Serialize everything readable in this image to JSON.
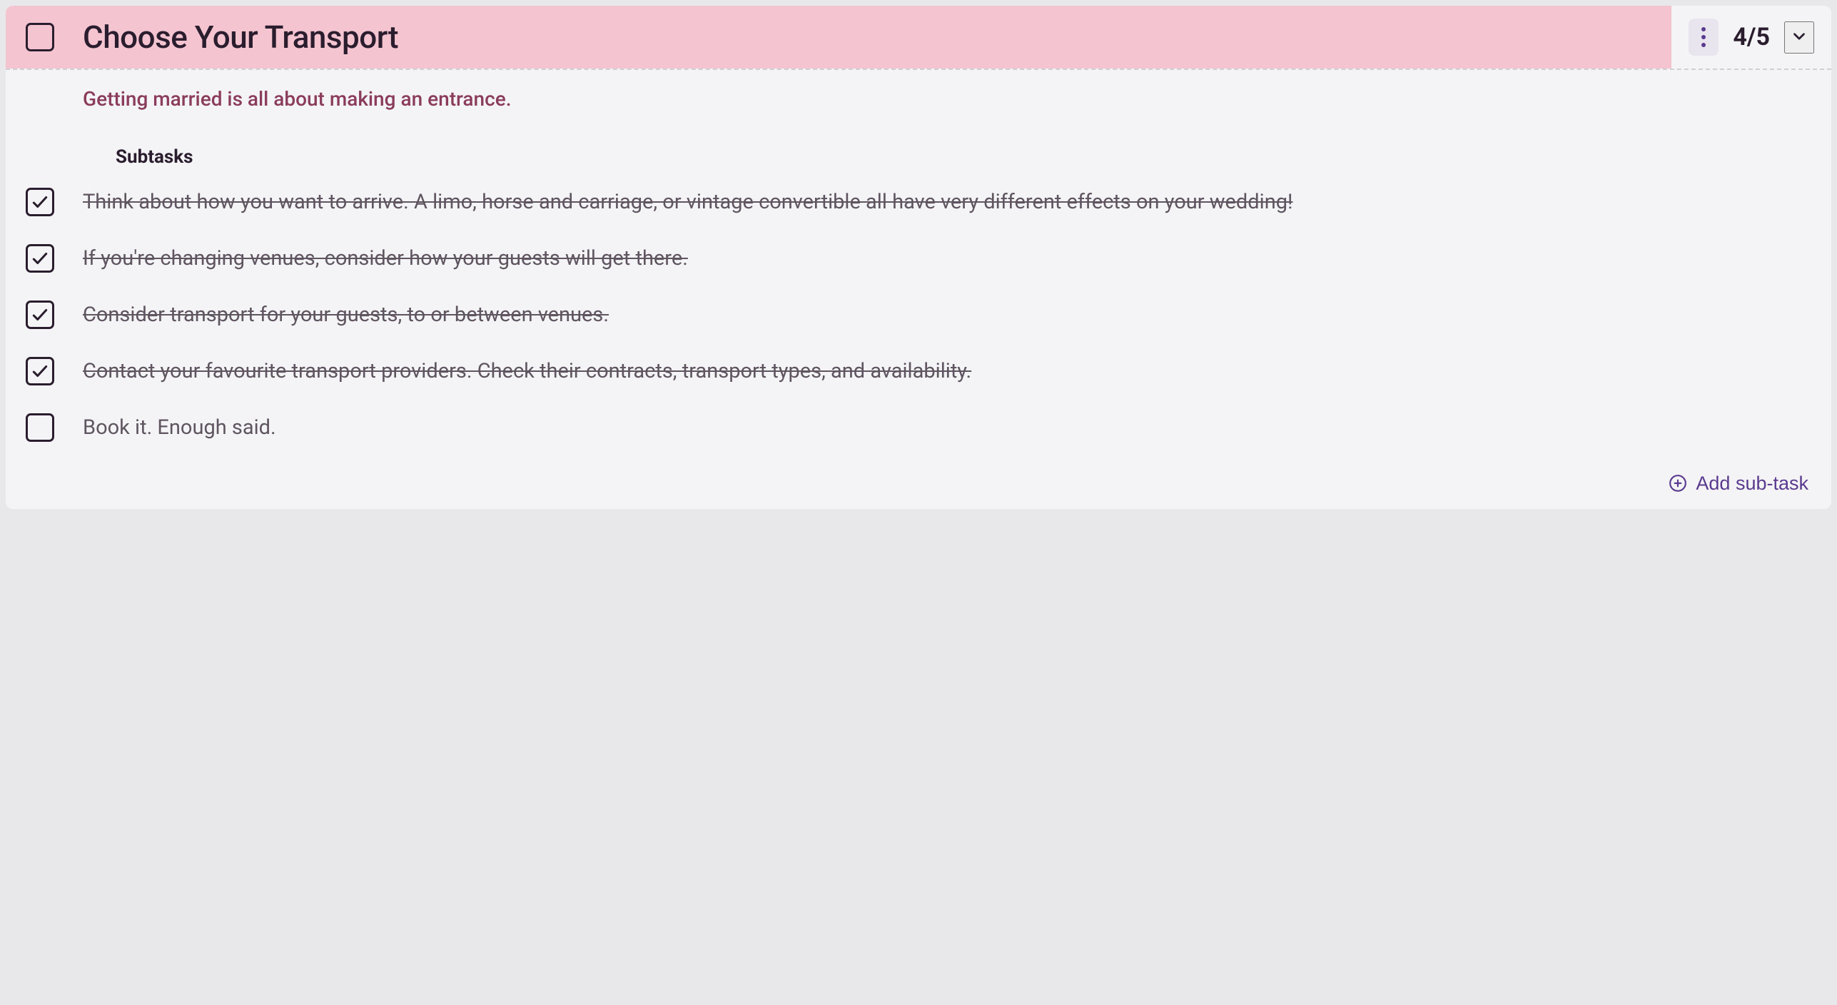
{
  "task": {
    "title": "Choose Your Transport",
    "completed": false,
    "progress": "4/5",
    "description": "Getting married is all about making an entrance."
  },
  "subtasks_heading": "Subtasks",
  "subtasks": [
    {
      "text": "Think about how you want to arrive. A limo, horse and carriage, or vintage convertible all have very different effects on your wedding!",
      "done": true
    },
    {
      "text": "If you're changing venues, consider how your guests will get there.",
      "done": true
    },
    {
      "text": "Consider transport for your guests, to or between venues.",
      "done": true
    },
    {
      "text": "Contact your favourite transport providers. Check their contracts, transport types, and availability.",
      "done": true
    },
    {
      "text": "Book it. Enough said.",
      "done": false
    }
  ],
  "add_subtask_label": "Add sub-task"
}
